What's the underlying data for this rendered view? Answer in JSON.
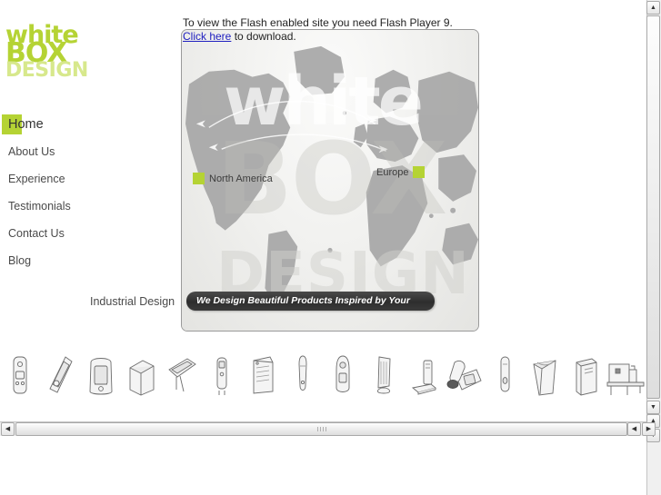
{
  "page": {
    "background_color": "#ffffff",
    "accent_green": "#b5d334",
    "link_color": "#2020c0"
  },
  "sidebar": {
    "logo": {
      "line1": "white",
      "line2": "BOX",
      "line3": "DESIGN"
    },
    "nav_items": [
      {
        "label": "Home",
        "active": true
      },
      {
        "label": "About Us",
        "active": false
      },
      {
        "label": "Experience",
        "active": false
      },
      {
        "label": "Testimonials",
        "active": false
      },
      {
        "label": "Contact Us",
        "active": false
      },
      {
        "label": "Blog",
        "active": false
      }
    ],
    "category_label": "Industrial Design"
  },
  "flash_notice": {
    "text_before": "To view the Flash enabled site you need Flash Player 9. ",
    "link_text": "Click here",
    "text_after": " to download."
  },
  "stage": {
    "watermark": {
      "word1": "white",
      "word2": "BOX",
      "word3": "DESIGN"
    },
    "pins": [
      {
        "label": "North America",
        "marker_side": "left",
        "color": "#b5d334"
      },
      {
        "label": "Europe",
        "marker_side": "right",
        "color": "#b5d334"
      }
    ],
    "tagline": "We Design Beautiful Products Inspired by Your Business Reality"
  },
  "thumbnails": [
    {
      "name": "handheld-device-sketch"
    },
    {
      "name": "angled-scanner-sketch"
    },
    {
      "name": "kiosk-enclosure-sketch"
    },
    {
      "name": "cube-box-sketch"
    },
    {
      "name": "tablet-stand-sketch"
    },
    {
      "name": "slim-remote-sketch"
    },
    {
      "name": "air-purifier-sketch"
    },
    {
      "name": "stylus-probe-sketch"
    },
    {
      "name": "handheld-remote-sketch"
    },
    {
      "name": "tower-fan-sketch"
    },
    {
      "name": "document-scanner-sketch"
    },
    {
      "name": "desk-phone-sketch"
    },
    {
      "name": "slim-controller-sketch"
    },
    {
      "name": "waste-bin-sketch"
    },
    {
      "name": "computer-tower-sketch"
    },
    {
      "name": "industrial-machine-sketch"
    }
  ],
  "scrollbars": {
    "vertical": {
      "up_glyph": "▲",
      "down_glyph": "▼"
    },
    "horizontal": {
      "left_glyph": "◀",
      "right_glyph": "▶"
    }
  }
}
